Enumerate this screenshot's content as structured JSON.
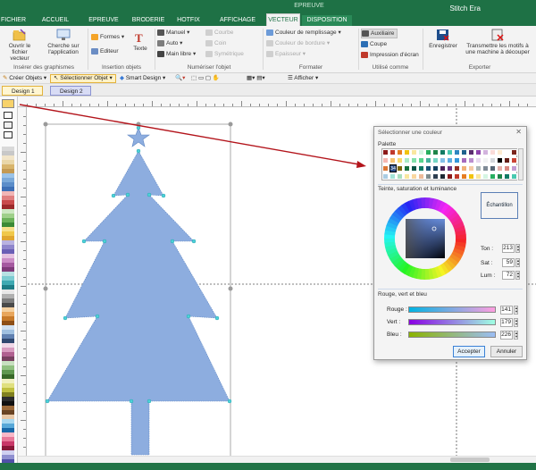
{
  "app": {
    "title": "Stitch Era",
    "contextual_group": "EPREUVE",
    "file_tab": "FICHIER",
    "tabs": [
      "ACCUEIL",
      "EPREUVE",
      "BRODERIE",
      "HOTFIX",
      "AFFICHAGE",
      "VECTEUR",
      "DISPOSITION"
    ],
    "active_tab": "VECTEUR"
  },
  "ribbon": {
    "groups": {
      "import": {
        "label": "Insérer des graphismes",
        "open_vector": "Ouvrir le fichier vecteur",
        "find_app": "Cherche sur l'application"
      },
      "objects": {
        "label": "Insertion objets",
        "forms": "Formes",
        "editor": "Editeur",
        "text": "Texte"
      },
      "digitize": {
        "label": "Numériser l'objet",
        "manual": "Manuel",
        "auto": "Auto",
        "freehand": "Main libre",
        "curve": "Courbe",
        "corner": "Coin",
        "symmetric": "Symétrique"
      },
      "format": {
        "label": "Formater",
        "fill_color": "Couleur de remplissage",
        "border_color": "Couleur de bordure",
        "thickness": "Epaisseur"
      },
      "usage": {
        "label": "Utilisé comme",
        "auxiliary": "Auxiliaire",
        "cut": "Coupe",
        "print": "Impression d'écran"
      },
      "export": {
        "label": "Exporter",
        "save": "Enregistrer",
        "transmit": "Transmettre les motifs à une machine à découper"
      }
    }
  },
  "toolbar": {
    "create_objects": "Créer Objets",
    "select_object": "Sélectionner Objet",
    "smart_design": "Smart Design",
    "show": "Afficher"
  },
  "doc_tabs": [
    "Design 1",
    "Design 2"
  ],
  "dialog": {
    "title": "Sélectionner une couleur",
    "palette_label": "Palette",
    "palette_selected_number": "34",
    "hsl_section": "Teinte, saturation et luminance",
    "sample_label": "Échantillon",
    "sample_color": "#8daddf",
    "hue_label": "Ton :",
    "hue_value": "213",
    "sat_label": "Sat :",
    "sat_value": "59",
    "lum_label": "Lum :",
    "lum_value": "72",
    "rgb_section": "Rouge, vert et bleu",
    "red_label": "Rouge :",
    "red_value": "141",
    "green_label": "Vert :",
    "green_value": "179",
    "blue_label": "Bleu :",
    "blue_value": "226",
    "accept_button": "Accepter",
    "cancel_button": "Annuler"
  },
  "colors": {
    "ribbon_green": "#1e7145",
    "tree_fill": "#8daddf",
    "arrow_red": "#b3141b"
  }
}
